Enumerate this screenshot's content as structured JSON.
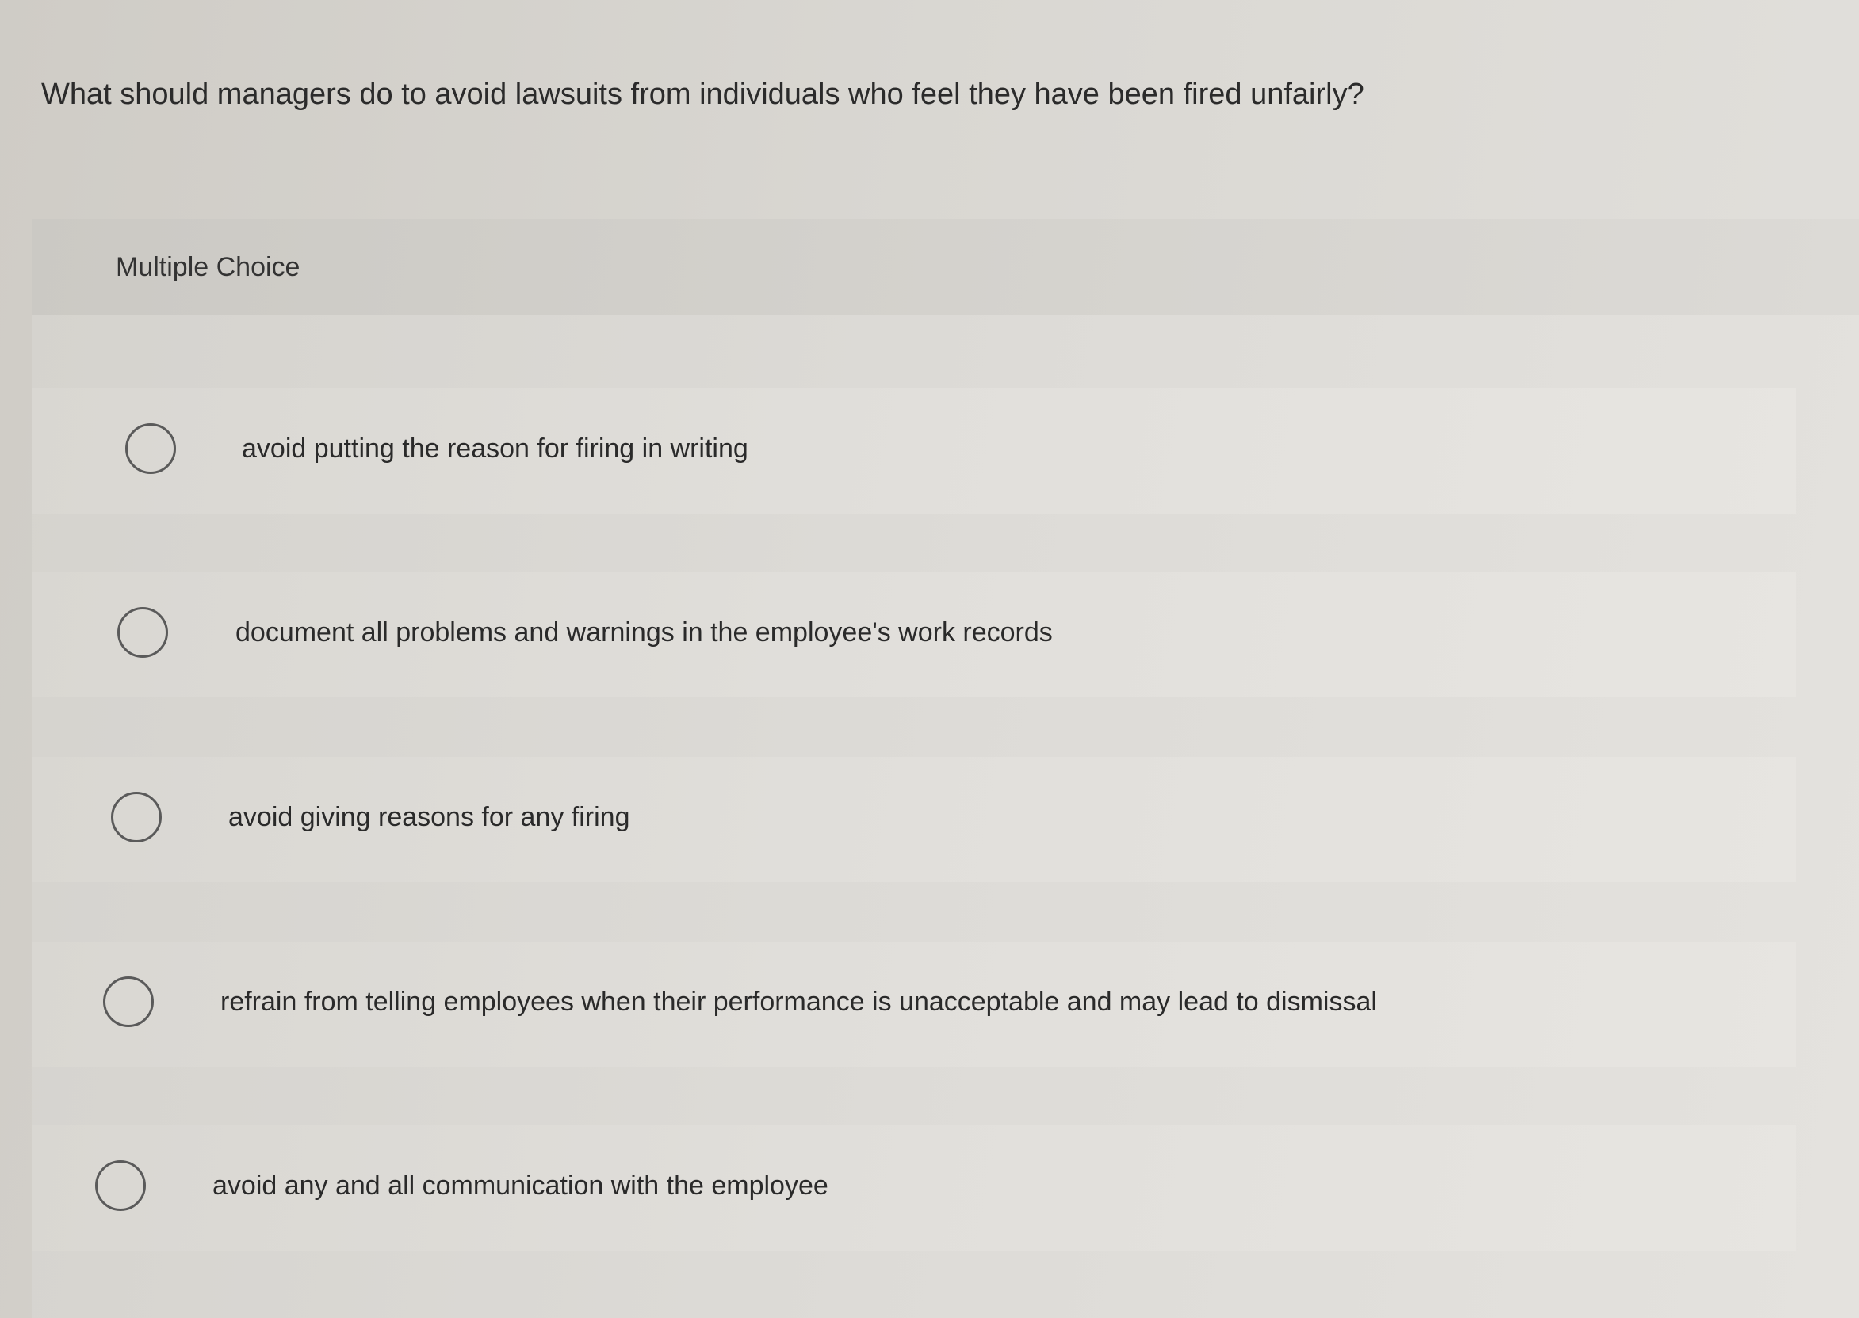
{
  "question": {
    "text": "What should managers do to avoid lawsuits from individuals who feel they have been fired unfairly?"
  },
  "mc": {
    "label": "Multiple Choice",
    "options": [
      {
        "text": "avoid putting the reason for firing in writing",
        "selected": false
      },
      {
        "text": "document all problems and warnings in the employee's work records",
        "selected": false
      },
      {
        "text": "avoid giving reasons for any firing",
        "selected": false
      },
      {
        "text": "refrain from telling employees when their performance is unacceptable and may lead to dismissal",
        "selected": false
      },
      {
        "text": "avoid any and all communication with the employee",
        "selected": false
      }
    ]
  }
}
